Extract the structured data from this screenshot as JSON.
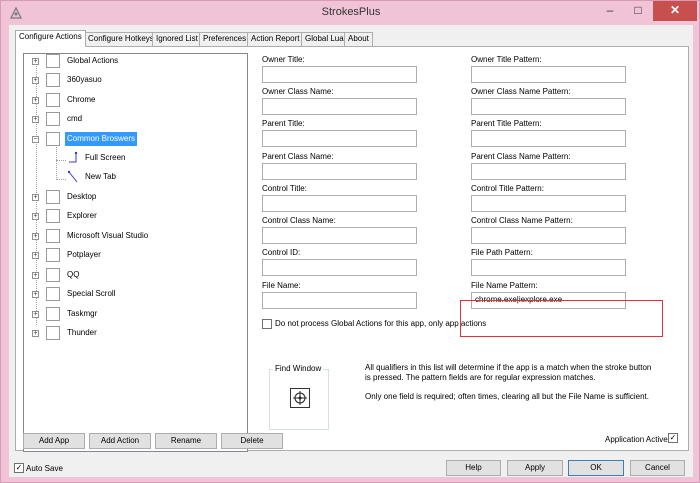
{
  "window": {
    "title": "StrokesPlus",
    "min": "–",
    "max": "□",
    "close": "✕"
  },
  "tabs": [
    "Configure Actions",
    "Configure Hotkeys",
    "Ignored List",
    "Preferences",
    "Action Report",
    "Global Lua",
    "About"
  ],
  "tree": {
    "items": [
      "Global Actions",
      "360yasuo",
      "Chrome",
      "cmd",
      "Common Broswers",
      "Full Screen",
      "New Tab",
      "Desktop",
      "Explorer",
      "Microsoft Visual Studio",
      "Potplayer",
      "QQ",
      "Special Scroll",
      "Taskmgr",
      "Thunder"
    ],
    "selected": "Common Broswers"
  },
  "fields": {
    "owner_title": {
      "label": "Owner Title:",
      "value": ""
    },
    "owner_title_pattern": {
      "label": "Owner Title Pattern:",
      "value": ""
    },
    "owner_class_name": {
      "label": "Owner Class Name:",
      "value": ""
    },
    "owner_class_name_pattern": {
      "label": "Owner Class Name Pattern:",
      "value": ""
    },
    "parent_title": {
      "label": "Parent Title:",
      "value": ""
    },
    "parent_title_pattern": {
      "label": "Parent Title Pattern:",
      "value": ""
    },
    "parent_class_name": {
      "label": "Parent Class Name:",
      "value": ""
    },
    "parent_class_name_pattern": {
      "label": "Parent Class Name Pattern:",
      "value": ""
    },
    "control_title": {
      "label": "Control Title:",
      "value": ""
    },
    "control_title_pattern": {
      "label": "Control Title Pattern:",
      "value": ""
    },
    "control_class_name": {
      "label": "Control Class Name:",
      "value": ""
    },
    "control_class_name_pattern": {
      "label": "Control Class Name Pattern:",
      "value": ""
    },
    "control_id": {
      "label": "Control ID:",
      "value": ""
    },
    "file_path_pattern": {
      "label": "File Path Pattern:",
      "value": ""
    },
    "file_name": {
      "label": "File Name:",
      "value": ""
    },
    "file_name_pattern": {
      "label": "File Name Pattern:",
      "value": "chrome.exe|iexplore.exe"
    }
  },
  "no_global_checkbox": {
    "label": "Do not process Global Actions for this app, only app actions",
    "checked": false
  },
  "find_window": {
    "label": "Find Window"
  },
  "info": {
    "line1": "All qualifiers in this list will determine if the app is a match when the stroke button is pressed. The pattern fields are for regular expression matches.",
    "line2": "Only one field is required; often times, clearing all but the File Name is sufficient."
  },
  "buttons": {
    "add_app": "Add App",
    "add_action": "Add Action",
    "rename": "Rename",
    "delete": "Delete",
    "help": "Help",
    "apply": "Apply",
    "ok": "OK",
    "cancel": "Cancel"
  },
  "application_active": {
    "label": "Application Active",
    "checked": true
  },
  "auto_save": {
    "label": "Auto Save",
    "checked": true
  },
  "colors": {
    "frame": "#f0c3d7",
    "selection": "#3399ff",
    "highlight_border": "#e0303a",
    "close_button": "#c7504f"
  }
}
